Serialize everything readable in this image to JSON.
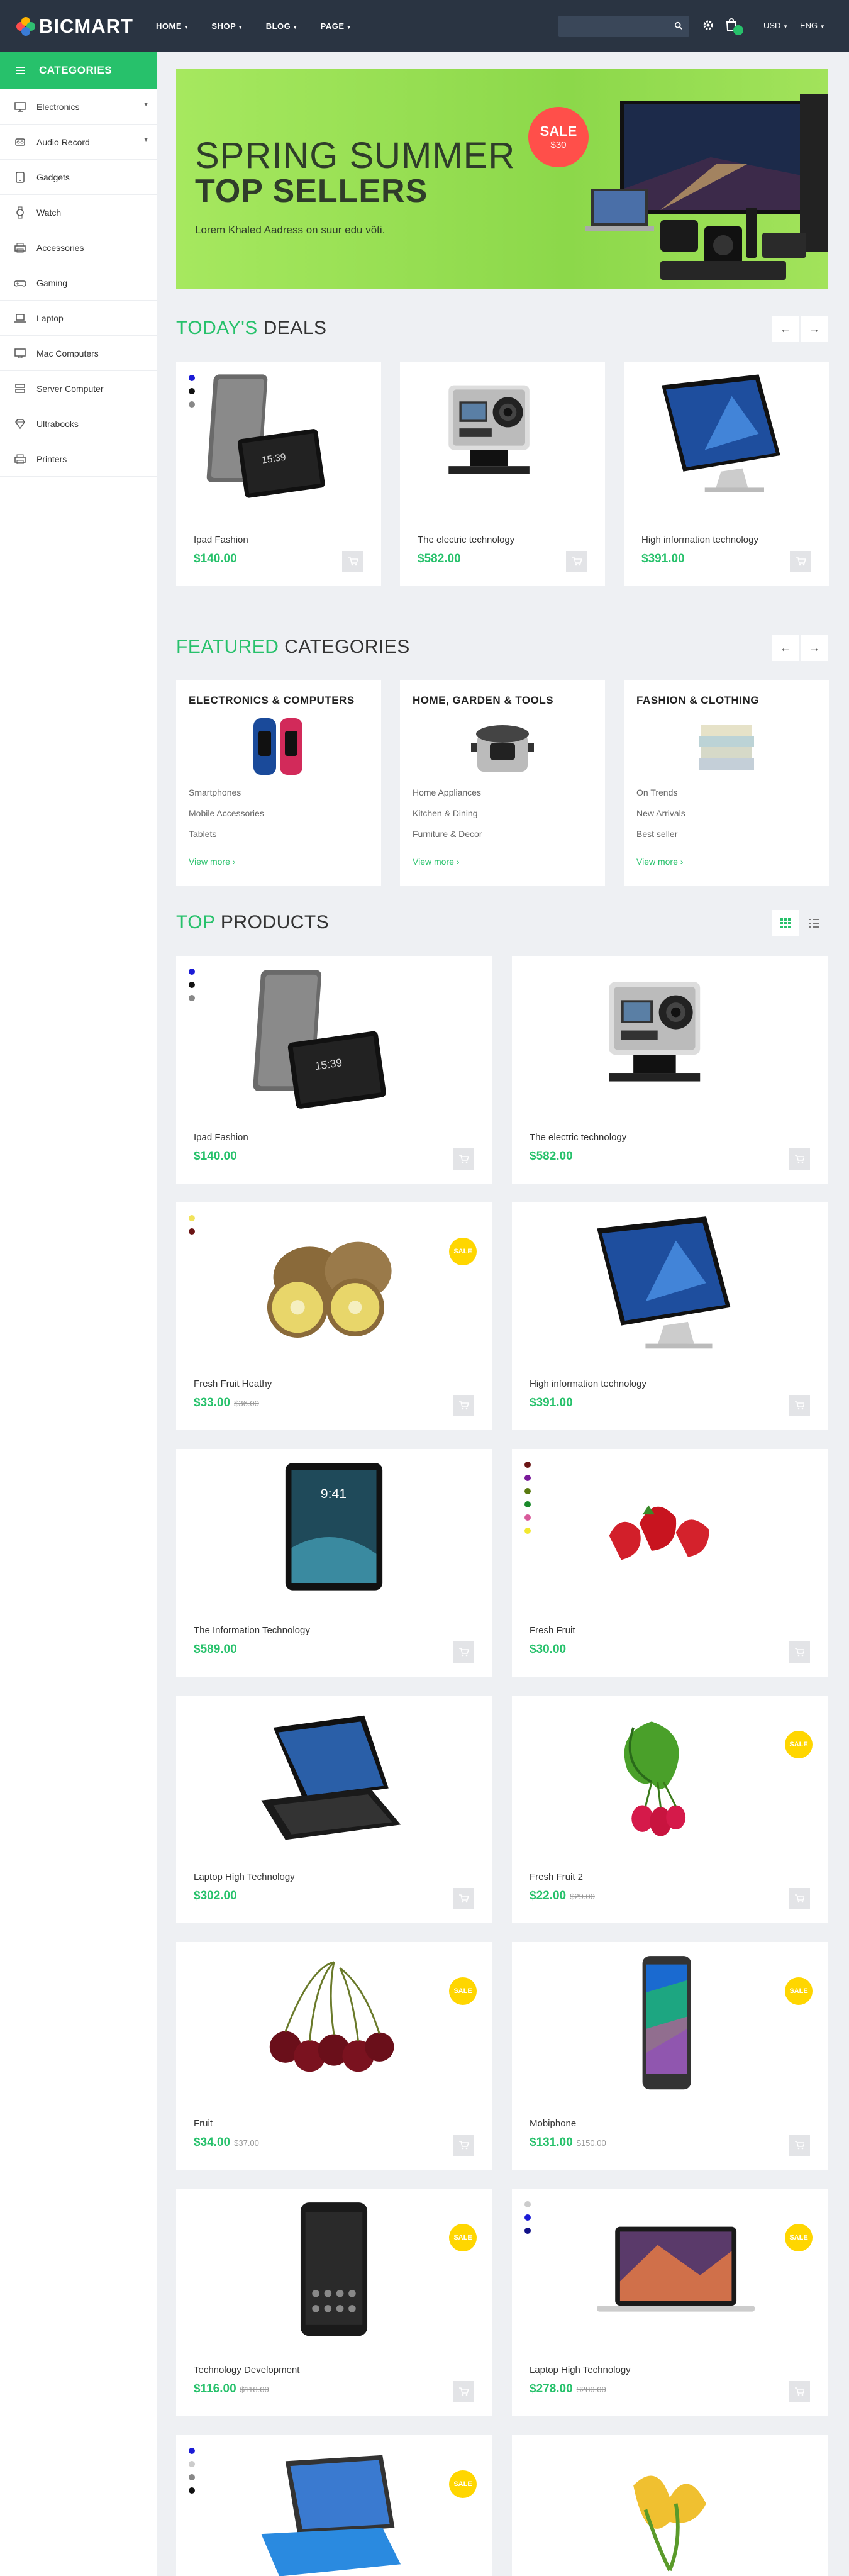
{
  "header": {
    "logo_text": "BICMART",
    "nav": [
      "HOME",
      "SHOP",
      "BLOG",
      "PAGE"
    ],
    "search_placeholder": "",
    "cart_count": "",
    "currency": "USD",
    "language": "ENG",
    "colors": {
      "bg": "#2a3442",
      "accent": "#27c16b"
    }
  },
  "sidebar": {
    "title": "CATEGORIES",
    "items": [
      {
        "label": "Electronics",
        "icon": "monitor-icon",
        "has_children": true
      },
      {
        "label": "Audio Record",
        "icon": "speaker-icon",
        "has_children": true
      },
      {
        "label": "Gadgets",
        "icon": "tablet-icon",
        "has_children": false
      },
      {
        "label": "Watch",
        "icon": "watch-icon",
        "has_children": false
      },
      {
        "label": "Accessories",
        "icon": "printer-icon",
        "has_children": false
      },
      {
        "label": "Gaming",
        "icon": "gamepad-icon",
        "has_children": false
      },
      {
        "label": "Laptop",
        "icon": "laptop-icon",
        "has_children": false
      },
      {
        "label": "Mac Computers",
        "icon": "desktop-icon",
        "has_children": false
      },
      {
        "label": "Server Computer",
        "icon": "server-icon",
        "has_children": false
      },
      {
        "label": "Ultrabooks",
        "icon": "diamond-icon",
        "has_children": false
      },
      {
        "label": "Printers",
        "icon": "printer-icon",
        "has_children": false
      }
    ]
  },
  "banner": {
    "line1": "SPRING SUMMER",
    "line2": "TOP SELLERS",
    "line3": "Lorem Khaled Aadress on suur edu võti.",
    "sale_label": "SALE",
    "sale_price": "$30"
  },
  "todays_deals": {
    "title_accent": "TODAY'S",
    "title_rest": " DEALS",
    "products": [
      {
        "name": "Ipad Fashion",
        "price": "$140.00",
        "image": "tablet-image",
        "swatches": [
          "#1b1bd6",
          "#111111",
          "#888888"
        ]
      },
      {
        "name": "The electric technology",
        "price": "$582.00",
        "image": "action-camera-image",
        "swatches": []
      },
      {
        "name": "High information technology",
        "price": "$391.00",
        "image": "desktop-monitor-image",
        "swatches": []
      }
    ]
  },
  "featured": {
    "title_accent": "FEATURED",
    "title_rest": " CATEGORIES",
    "categories": [
      {
        "title": "ELECTRONICS & COMPUTERS",
        "links": [
          "Smartphones",
          "Mobile Accessories",
          "Tablets"
        ],
        "more": "View more ›",
        "image": "fitness-band-image"
      },
      {
        "title": "HOME, GARDEN & TOOLS",
        "links": [
          "Home Appliances",
          "Kitchen & Dining",
          "Furniture & Decor"
        ],
        "more": "View more ›",
        "image": "cooker-image"
      },
      {
        "title": "FASHION & CLOTHING",
        "links": [
          "On Trends",
          "New Arrivals",
          "Best seller"
        ],
        "more": "View more ›",
        "image": "folded-clothes-image"
      }
    ]
  },
  "top_products": {
    "title_accent": "TOP",
    "title_rest": " PRODUCTS",
    "sale_badge": "SALE",
    "products": [
      {
        "name": "Ipad Fashion",
        "price": "$140.00",
        "old_price": "",
        "sale": false,
        "image": "tablet-image",
        "swatches": [
          "#1b1bd6",
          "#111111",
          "#888888"
        ]
      },
      {
        "name": "The electric technology",
        "price": "$582.00",
        "old_price": "",
        "sale": false,
        "image": "action-camera-image",
        "swatches": []
      },
      {
        "name": "Fresh Fruit Heathy",
        "price": "$33.00",
        "old_price": "$36.00",
        "sale": true,
        "image": "kiwi-image",
        "swatches": [
          "#f2e35a",
          "#6b1515"
        ]
      },
      {
        "name": "High information technology",
        "price": "$391.00",
        "old_price": "",
        "sale": false,
        "image": "desktop-monitor-image",
        "swatches": []
      },
      {
        "name": "The Information Technology",
        "price": "$589.00",
        "old_price": "",
        "sale": false,
        "image": "ipad-image",
        "swatches": []
      },
      {
        "name": "Fresh Fruit",
        "price": "$30.00",
        "old_price": "",
        "sale": false,
        "image": "strawberry-image",
        "swatches": [
          "#6b1515",
          "#7a1a9a",
          "#5a7a10",
          "#1a8a2a",
          "#d85a9a",
          "#f2e830"
        ]
      },
      {
        "name": "Laptop High Technology",
        "price": "$302.00",
        "old_price": "",
        "sale": false,
        "image": "convertible-laptop-image",
        "swatches": []
      },
      {
        "name": "Fresh Fruit 2",
        "price": "$22.00",
        "old_price": "$29.00",
        "sale": true,
        "image": "radish-image",
        "swatches": []
      },
      {
        "name": "Fruit",
        "price": "$34.00",
        "old_price": "$37.00",
        "sale": true,
        "image": "cherries-image",
        "swatches": []
      },
      {
        "name": "Mobiphone",
        "price": "$131.00",
        "old_price": "$150.00",
        "sale": true,
        "image": "smartphone-image",
        "swatches": []
      },
      {
        "name": "Technology Development",
        "price": "$116.00",
        "old_price": "$118.00",
        "sale": true,
        "image": "black-phone-image",
        "swatches": []
      },
      {
        "name": "Laptop High Technology",
        "price": "$278.00",
        "old_price": "$280.00",
        "sale": true,
        "image": "macbook-image",
        "swatches": [
          "#cccccc",
          "#1b1bd6",
          "#111188"
        ]
      },
      {
        "name": "",
        "price": "",
        "old_price": "",
        "sale": true,
        "image": "surface-laptop-image",
        "swatches": [
          "#1b1bd6",
          "#cccccc",
          "#888888",
          "#111111"
        ]
      },
      {
        "name": "",
        "price": "",
        "old_price": "",
        "sale": false,
        "image": "yellow-flowers-image",
        "swatches": []
      }
    ]
  }
}
